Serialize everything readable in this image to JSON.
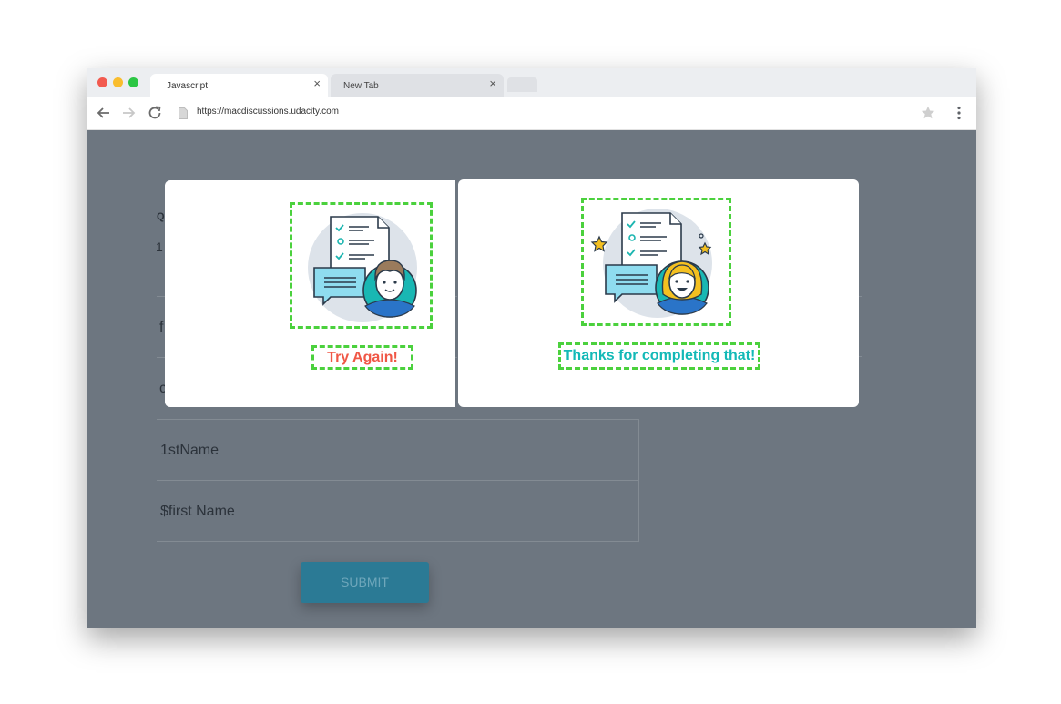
{
  "browser": {
    "tabs": [
      {
        "title": "Javascript",
        "close": "×"
      },
      {
        "title": "New Tab",
        "close": "×"
      }
    ],
    "url": "https://macdiscussions.udacity.com"
  },
  "page": {
    "question_label": "Q",
    "question_text": "1",
    "options": [
      "f",
      "c",
      "1stName",
      "$first Name"
    ],
    "submit_label": "SUBMIT"
  },
  "feedback": {
    "wrong_message": "Try Again!",
    "right_message": "Thanks for completing that!"
  },
  "colors": {
    "dashed_outline": "#4bd13d",
    "wrong_text": "#f05746",
    "right_text": "#13b9b7",
    "overlay": "#6d7680",
    "submit": "#2b7a95"
  }
}
